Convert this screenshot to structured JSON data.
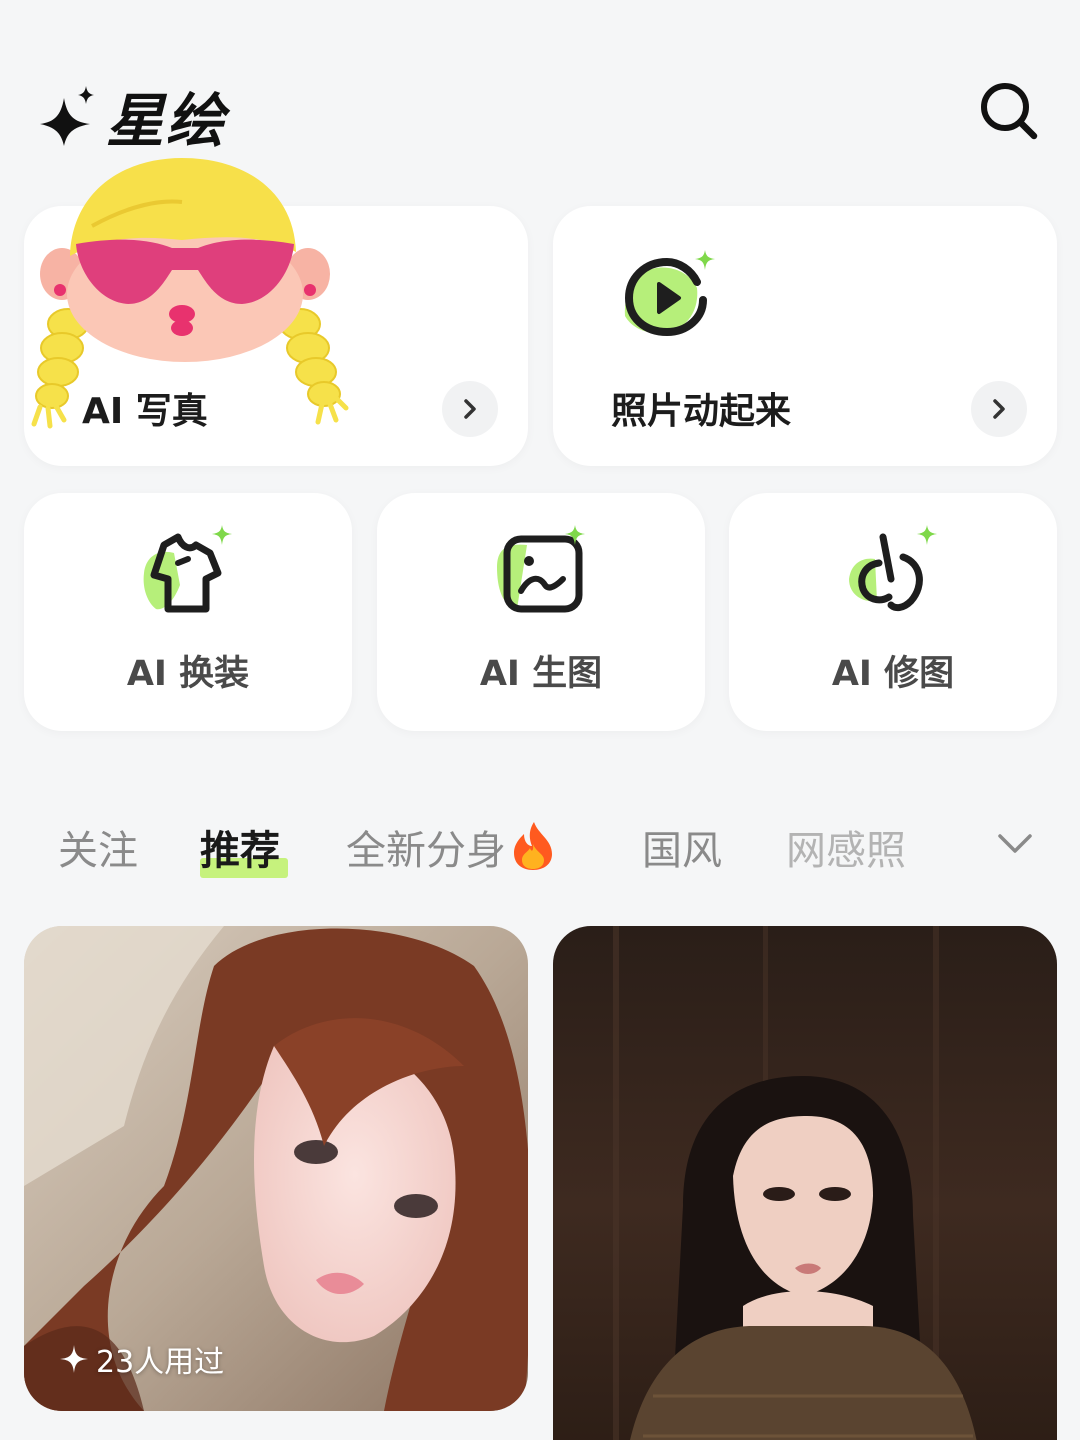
{
  "app": {
    "name": "星绘"
  },
  "features_large": [
    {
      "label": "AI 写真",
      "icon": "portrait-sticker-icon"
    },
    {
      "label": "照片动起来",
      "icon": "play-sparkle-icon"
    }
  ],
  "features_small": [
    {
      "label": "AI 换装",
      "icon": "shirt-sparkle-icon"
    },
    {
      "label": "AI 生图",
      "icon": "image-sparkle-icon"
    },
    {
      "label": "AI 修图",
      "icon": "edit-sparkle-icon"
    }
  ],
  "tabs": [
    {
      "label": "关注",
      "active": false
    },
    {
      "label": "推荐",
      "active": true
    },
    {
      "label": "全新分身",
      "active": false,
      "badge": "fire-icon"
    },
    {
      "label": "国风",
      "active": false
    },
    {
      "label": "网感照",
      "active": false
    }
  ],
  "feed": [
    {
      "usage": "23人用过"
    }
  ],
  "colors": {
    "accent_green": "#8be05a",
    "tab_highlight": "#c6f27d",
    "background": "#f5f6f7"
  }
}
